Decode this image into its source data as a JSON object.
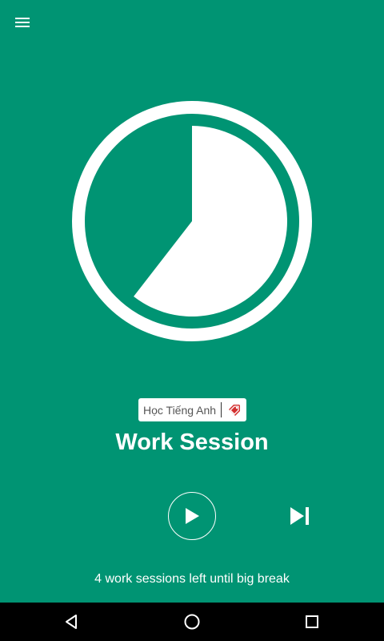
{
  "toolbar": {
    "menu_icon": "hamburger-menu-icon"
  },
  "timer": {
    "progress_remaining_fraction": 0.605,
    "ring_color": "#ffffff",
    "background_color": "#009473"
  },
  "session": {
    "label": "Học Tiếng Anh",
    "label_icon": "tag-icon",
    "label_icon_color": "#d32f2f",
    "title": "Work Session",
    "status": "4 work sessions left until big break"
  },
  "controls": {
    "play_icon": "play-icon",
    "skip_icon": "skip-next-icon"
  },
  "navbar": {
    "back_icon": "back-triangle-icon",
    "home_icon": "home-circle-icon",
    "recents_icon": "recents-square-icon"
  }
}
